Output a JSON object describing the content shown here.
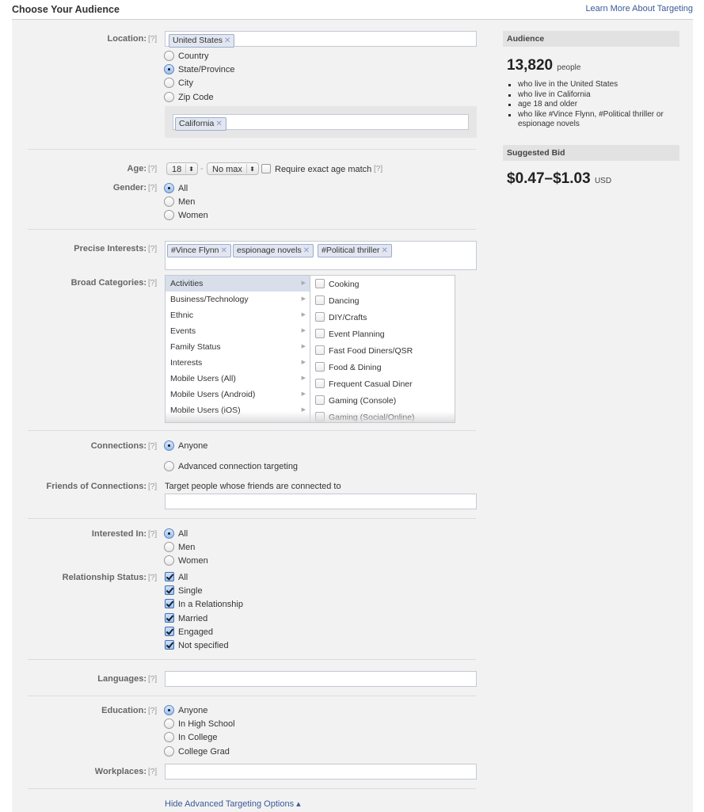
{
  "header": {
    "title": "Choose Your Audience",
    "learn_more": "Learn More About Targeting"
  },
  "help_marker": "[?]",
  "location": {
    "label": "Location:",
    "tokens": [
      "United States"
    ],
    "options": [
      {
        "label": "Country",
        "selected": false
      },
      {
        "label": "State/Province",
        "selected": true
      },
      {
        "label": "City",
        "selected": false
      },
      {
        "label": "Zip Code",
        "selected": false
      }
    ],
    "sub_tokens": [
      "California"
    ]
  },
  "age": {
    "label": "Age:",
    "min": "18",
    "dash": "-",
    "max": "No max",
    "exact_match_label": "Require exact age match",
    "exact_match_checked": false
  },
  "gender": {
    "label": "Gender:",
    "options": [
      {
        "label": "All",
        "selected": true
      },
      {
        "label": "Men",
        "selected": false
      },
      {
        "label": "Women",
        "selected": false
      }
    ]
  },
  "precise_interests": {
    "label": "Precise Interests:",
    "tokens": [
      "#Vince Flynn",
      "espionage novels",
      "#Political thriller"
    ]
  },
  "broad_categories": {
    "label": "Broad Categories:",
    "categories": [
      {
        "label": "Activities",
        "selected": true
      },
      {
        "label": "Business/Technology",
        "selected": false
      },
      {
        "label": "Ethnic",
        "selected": false
      },
      {
        "label": "Events",
        "selected": false
      },
      {
        "label": "Family Status",
        "selected": false
      },
      {
        "label": "Interests",
        "selected": false
      },
      {
        "label": "Mobile Users (All)",
        "selected": false
      },
      {
        "label": "Mobile Users (Android)",
        "selected": false
      },
      {
        "label": "Mobile Users (iOS)",
        "selected": false
      }
    ],
    "subcategories": [
      {
        "label": "Cooking",
        "checked": false
      },
      {
        "label": "Dancing",
        "checked": false
      },
      {
        "label": "DIY/Crafts",
        "checked": false
      },
      {
        "label": "Event Planning",
        "checked": false
      },
      {
        "label": "Fast Food Diners/QSR",
        "checked": false
      },
      {
        "label": "Food & Dining",
        "checked": false
      },
      {
        "label": "Frequent Casual Diner",
        "checked": false
      },
      {
        "label": "Gaming (Console)",
        "checked": false
      },
      {
        "label": "Gaming (Social/Online)",
        "checked": false
      }
    ]
  },
  "connections": {
    "label": "Connections:",
    "options": [
      {
        "label": "Anyone",
        "selected": true
      },
      {
        "label": "Advanced connection targeting",
        "selected": false
      }
    ]
  },
  "friends_of_connections": {
    "label": "Friends of Connections:",
    "description": "Target people whose friends are connected to",
    "value": ""
  },
  "interested_in": {
    "label": "Interested In:",
    "options": [
      {
        "label": "All",
        "selected": true
      },
      {
        "label": "Men",
        "selected": false
      },
      {
        "label": "Women",
        "selected": false
      }
    ]
  },
  "relationship_status": {
    "label": "Relationship Status:",
    "options": [
      {
        "label": "All",
        "checked": true
      },
      {
        "label": "Single",
        "checked": true
      },
      {
        "label": "In a Relationship",
        "checked": true
      },
      {
        "label": "Married",
        "checked": true
      },
      {
        "label": "Engaged",
        "checked": true
      },
      {
        "label": "Not specified",
        "checked": true
      }
    ]
  },
  "languages": {
    "label": "Languages:",
    "value": ""
  },
  "education": {
    "label": "Education:",
    "options": [
      {
        "label": "Anyone",
        "selected": true
      },
      {
        "label": "In High School",
        "selected": false
      },
      {
        "label": "In College",
        "selected": false
      },
      {
        "label": "College Grad",
        "selected": false
      }
    ]
  },
  "workplaces": {
    "label": "Workplaces:",
    "value": ""
  },
  "hide_advanced": "Hide Advanced Targeting Options ▴",
  "audience": {
    "heading": "Audience",
    "count": "13,820",
    "count_unit": "people",
    "criteria": [
      "who live in the United States",
      "who live in California",
      "age 18 and older",
      "who like #Vince Flynn, #Political thriller or espionage novels"
    ]
  },
  "suggested_bid": {
    "heading": "Suggested Bid",
    "range": "$0.47–$1.03",
    "currency": "USD"
  }
}
